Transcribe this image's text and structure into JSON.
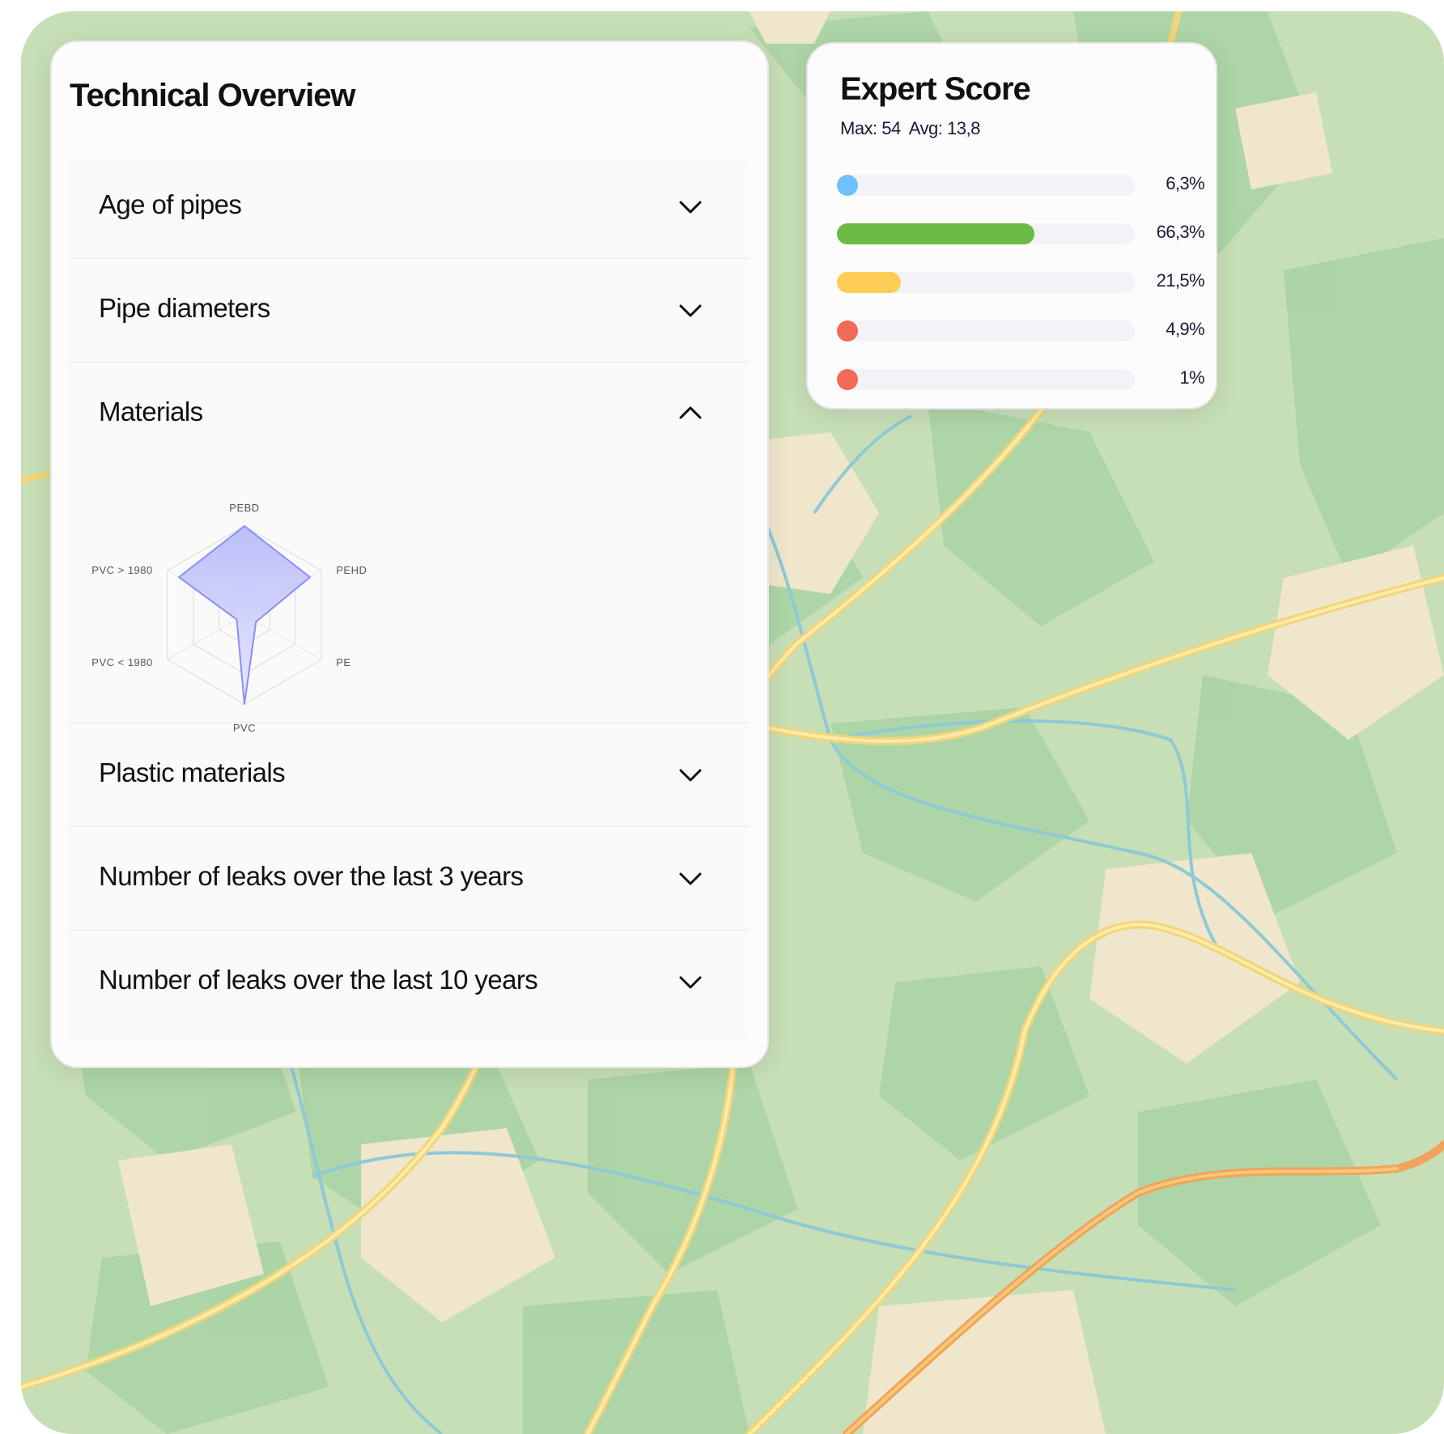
{
  "technical_overview": {
    "title": "Technical Overview",
    "sections": [
      {
        "label": "Age of pipes",
        "expanded": false
      },
      {
        "label": "Pipe diameters",
        "expanded": false
      },
      {
        "label": "Materials",
        "expanded": true
      },
      {
        "label": "Plastic materials",
        "expanded": false
      },
      {
        "label": "Number of leaks over the last 3 years",
        "expanded": false
      },
      {
        "label": "Number of leaks over the last 10 years",
        "expanded": false
      }
    ],
    "materials_chart": {
      "axes": [
        "PEBD",
        "PEHD",
        "PE",
        "PVC",
        "PVC < 1980",
        "PVC > 1980"
      ],
      "values": [
        1.0,
        0.85,
        0.15,
        1.0,
        0.1,
        0.85
      ],
      "fill_color": "#c9ccfb",
      "line_color": "#8a8ff5"
    }
  },
  "expert_score": {
    "title": "Expert Score",
    "max": "Max: 54",
    "avg": "Avg: 13,8",
    "bars": [
      {
        "label": "6,3%",
        "fraction": 0.063,
        "color": "#6ec1ff"
      },
      {
        "label": "66,3%",
        "fraction": 0.663,
        "color": "#6cba45"
      },
      {
        "label": "21,5%",
        "fraction": 0.215,
        "color": "#fdcd55"
      },
      {
        "label": "4,9%",
        "fraction": 0.049,
        "color": "#f26a5a"
      },
      {
        "label": "1%",
        "fraction": 0.01,
        "color": "#f26a5a"
      }
    ]
  },
  "icons": {
    "collapsed": "chevron-down-icon",
    "expanded": "chevron-up-icon"
  }
}
